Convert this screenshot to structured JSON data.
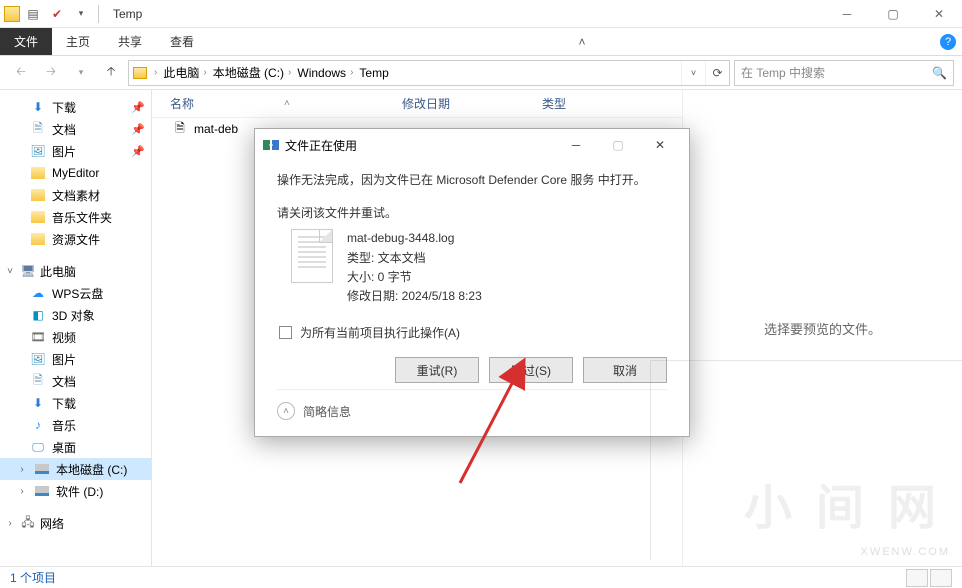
{
  "window": {
    "title": "Temp"
  },
  "ribbon": {
    "file": "文件",
    "home": "主页",
    "share": "共享",
    "view": "查看"
  },
  "breadcrumb": {
    "items": [
      "此电脑",
      "本地磁盘 (C:)",
      "Windows",
      "Temp"
    ]
  },
  "search": {
    "placeholder": "在 Temp 中搜索"
  },
  "sidebar": {
    "quick": [
      {
        "label": "下载",
        "pin": true
      },
      {
        "label": "文档",
        "pin": true
      },
      {
        "label": "图片",
        "pin": true
      },
      {
        "label": "MyEditor",
        "pin": false
      },
      {
        "label": "文档素材",
        "pin": false
      },
      {
        "label": "音乐文件夹",
        "pin": false
      },
      {
        "label": "资源文件",
        "pin": false
      }
    ],
    "pc_label": "此电脑",
    "pc": [
      {
        "label": "WPS云盘"
      },
      {
        "label": "3D 对象"
      },
      {
        "label": "视频"
      },
      {
        "label": "图片"
      },
      {
        "label": "文档"
      },
      {
        "label": "下载"
      },
      {
        "label": "音乐"
      },
      {
        "label": "桌面"
      },
      {
        "label": "本地磁盘 (C:)",
        "active": true
      },
      {
        "label": "软件 (D:)"
      }
    ],
    "network_label": "网络"
  },
  "columns": {
    "name": "名称",
    "modified": "修改日期",
    "type": "类型"
  },
  "files": [
    {
      "name": "mat-deb"
    }
  ],
  "preview_text": "选择要预览的文件。",
  "status": {
    "count": "1 个项目"
  },
  "dialog": {
    "title": "文件正在使用",
    "line1": "操作无法完成，因为文件已在 Microsoft Defender Core 服务 中打开。",
    "line2": "请关闭该文件并重试。",
    "file": {
      "name": "mat-debug-3448.log",
      "type_label": "类型: 文本文档",
      "size_label": "大小: 0 字节",
      "mod_label": "修改日期: 2024/5/18 8:23"
    },
    "checkbox": "为所有当前项目执行此操作(A)",
    "retry": "重试(R)",
    "skip": "跳过(S)",
    "cancel": "取消",
    "less_info": "简略信息"
  },
  "watermark": "小 间 网",
  "watermark_url": "XWENW.COM"
}
